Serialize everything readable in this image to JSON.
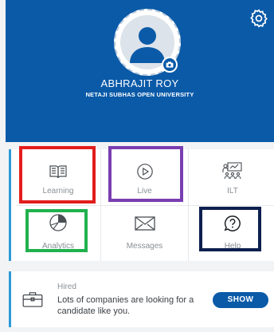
{
  "profile": {
    "name": "ABHRAJIT ROY",
    "university": "NETAJI SUBHAS OPEN UNIVERSITY",
    "settings_icon": "gear-icon",
    "avatar_icon": "user-avatar-icon",
    "camera_icon": "camera-icon"
  },
  "menu": {
    "items": [
      {
        "label": "Learning",
        "icon": "book-icon"
      },
      {
        "label": "Live",
        "icon": "play-circle-icon"
      },
      {
        "label": "ILT",
        "icon": "classroom-icon"
      },
      {
        "label": "Analytics",
        "icon": "pie-chart-icon"
      },
      {
        "label": "Messages",
        "icon": "envelope-icon"
      },
      {
        "label": "Help",
        "icon": "help-bubble-icon"
      }
    ]
  },
  "hired": {
    "title": "Hired",
    "text": "Lots of companies are looking for a candidate like you.",
    "button": "SHOW",
    "icon": "briefcase-icon"
  },
  "colors": {
    "brand_blue": "#0a5aa8",
    "accent_blue": "#2c9ad8",
    "highlight_red": "#e31d1d",
    "highlight_purple": "#7a3eb1",
    "highlight_green": "#21b14e",
    "highlight_navy": "#0c1f4e"
  }
}
